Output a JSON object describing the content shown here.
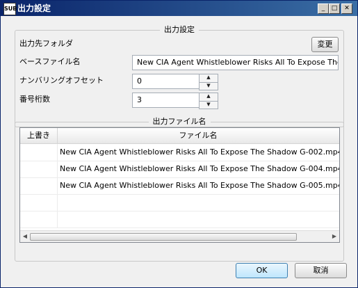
{
  "window": {
    "title": "出力設定",
    "icon": "SUB",
    "controls": [
      "_",
      "□",
      "✕"
    ]
  },
  "output_settings": {
    "group_title": "出力設定",
    "output_folder_label": "出力先フォルダ",
    "change_button": "変更",
    "base_name_label": "ベースファイル名",
    "base_name_value": "New CIA Agent Whistleblower Risks All To Expose The S",
    "numbering_offset_label": "ナンバリングオフセット",
    "numbering_offset_value": "0",
    "digits_label": "番号桁数",
    "digits_value": "3"
  },
  "output_files": {
    "group_title": "出力ファイル名",
    "columns": [
      "上書き",
      "ファイル名"
    ],
    "rows": [
      {
        "overwrite": "",
        "filename": "New CIA Agent Whistleblower Risks All To Expose The Shadow G-002.mp4"
      },
      {
        "overwrite": "",
        "filename": "New CIA Agent Whistleblower Risks All To Expose The Shadow G-004.mp4"
      },
      {
        "overwrite": "",
        "filename": "New CIA Agent Whistleblower Risks All To Expose The Shadow G-005.mp4"
      },
      {
        "overwrite": "",
        "filename": ""
      },
      {
        "overwrite": "",
        "filename": ""
      }
    ]
  },
  "buttons": {
    "ok": "OK",
    "cancel": "取消"
  }
}
